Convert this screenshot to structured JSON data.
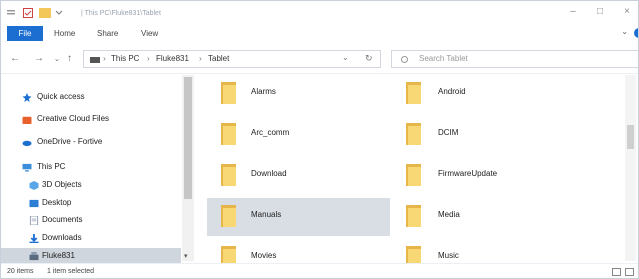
{
  "titlebar": {
    "path": "| This PC\\Fluke831\\Tablet"
  },
  "ribbon": {
    "tabs": [
      "File",
      "Home",
      "Share",
      "View"
    ]
  },
  "address": {
    "crumbs": [
      "This PC",
      "Fluke831",
      "Tablet"
    ],
    "search_placeholder": "Search Tablet"
  },
  "nav": {
    "items": [
      {
        "label": "Quick access",
        "icon": "pin-icon",
        "color": "#1c6fd1"
      },
      {
        "label": "Creative Cloud Files",
        "icon": "creative-cloud-icon",
        "color": "#e8612c"
      },
      {
        "label": "OneDrive - Fortive",
        "icon": "cloud-icon",
        "color": "#1c6fd1"
      },
      {
        "label": "This PC",
        "icon": "computer-icon",
        "color": "#3a8fd8"
      },
      {
        "label": "3D Objects",
        "icon": "cube-icon",
        "color": "#5aa7e8"
      },
      {
        "label": "Desktop",
        "icon": "desktop-icon",
        "color": "#2a7fd4"
      },
      {
        "label": "Documents",
        "icon": "document-icon",
        "color": "#8a9bb0"
      },
      {
        "label": "Downloads",
        "icon": "download-icon",
        "color": "#1c6fd1"
      },
      {
        "label": "Fluke831",
        "icon": "device-icon",
        "color": "#5a6b80"
      }
    ]
  },
  "folders": {
    "col1": [
      "Alarms",
      "Arc_comm",
      "Download",
      "Manuals",
      "Movies"
    ],
    "col2": [
      "Android",
      "DCIM",
      "FirmwareUpdate",
      "Media",
      "Music"
    ]
  },
  "status": {
    "count": "20 items",
    "selection": "1 item selected"
  }
}
